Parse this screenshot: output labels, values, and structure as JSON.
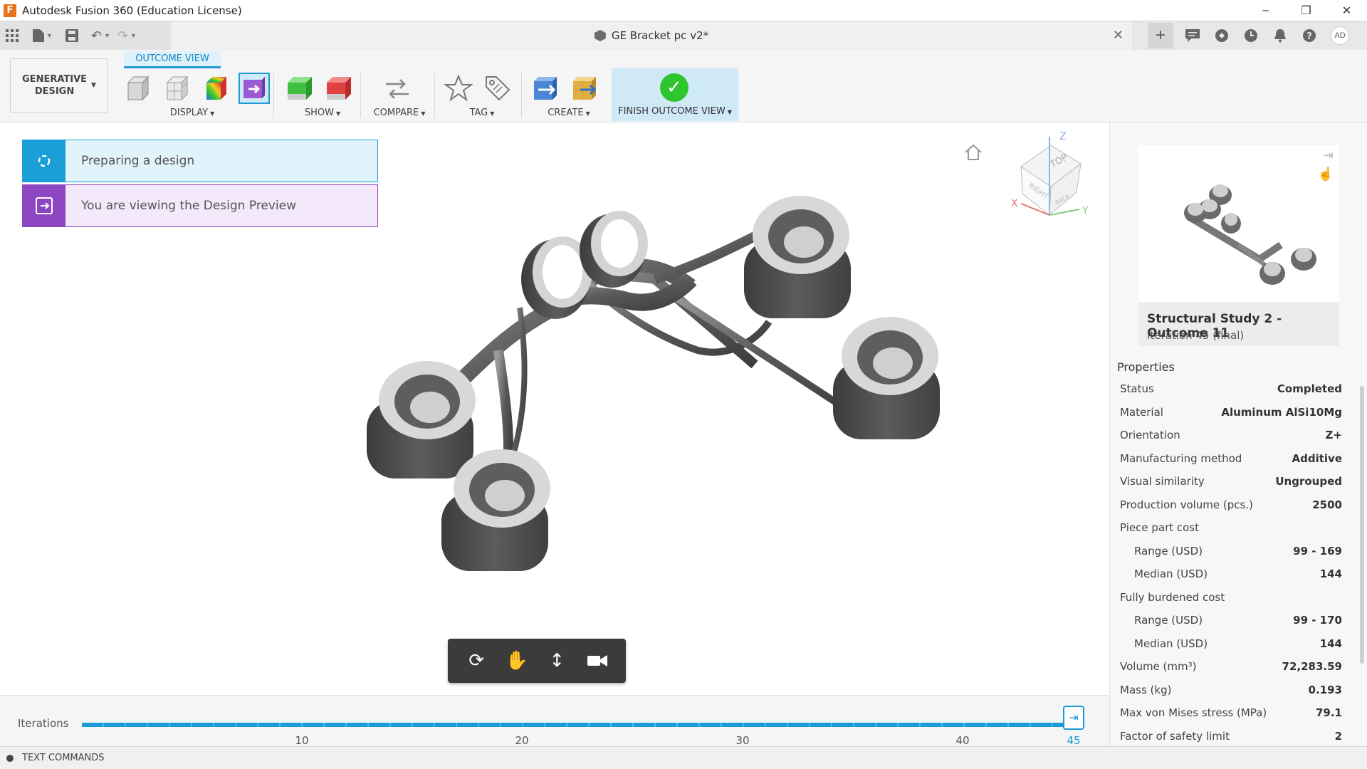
{
  "window": {
    "title": "Autodesk Fusion 360 (Education License)",
    "app_letter": "F",
    "controls": [
      "–",
      "❐",
      "✕"
    ]
  },
  "document": {
    "name": "GE Bracket pc v2*",
    "user_initials": "AD"
  },
  "ribbon": {
    "workspace_line1": "GENERATIVE",
    "workspace_line2": "DESIGN",
    "active_tab": "OUTCOME VIEW",
    "groups": {
      "display": "DISPLAY",
      "show": "SHOW",
      "compare": "COMPARE",
      "tag": "TAG",
      "create": "CREATE",
      "finish": "FINISH OUTCOME VIEW"
    }
  },
  "notices": {
    "preparing": "Preparing a design",
    "viewing": "You are viewing the Design Preview"
  },
  "timeline": {
    "label": "Iterations",
    "ticks": [
      "10",
      "20",
      "30",
      "40",
      "45"
    ],
    "current_iteration": 45
  },
  "text_commands": "TEXT COMMANDS",
  "outcome": {
    "title": "Structural Study 2 - Outcome 11",
    "subtitle": "Iteration 45 (final)"
  },
  "properties": {
    "heading": "Properties",
    "rows": [
      {
        "label": "Status",
        "value": "Completed",
        "sub": false
      },
      {
        "label": "Material",
        "value": "Aluminum AlSi10Mg",
        "sub": false
      },
      {
        "label": "Orientation",
        "value": "Z+",
        "sub": false
      },
      {
        "label": "Manufacturing method",
        "value": "Additive",
        "sub": false
      },
      {
        "label": "Visual similarity",
        "value": "Ungrouped",
        "sub": false
      },
      {
        "label": "Production volume (pcs.)",
        "value": "2500",
        "sub": false
      },
      {
        "label": "Piece part cost",
        "value": "",
        "sub": false
      },
      {
        "label": "Range (USD)",
        "value": "99 - 169",
        "sub": true
      },
      {
        "label": "Median (USD)",
        "value": "144",
        "sub": true
      },
      {
        "label": "Fully burdened cost",
        "value": "",
        "sub": false
      },
      {
        "label": "Range (USD)",
        "value": "99 - 170",
        "sub": true
      },
      {
        "label": "Median (USD)",
        "value": "144",
        "sub": true
      },
      {
        "label": "Volume (mm³)",
        "value": "72,283.59",
        "sub": false
      },
      {
        "label": "Mass (kg)",
        "value": "0.193",
        "sub": false
      },
      {
        "label": "Max von Mises stress (MPa)",
        "value": "79.1",
        "sub": false
      },
      {
        "label": "Factor of safety limit",
        "value": "2",
        "sub": false
      }
    ]
  },
  "viewcube": {
    "top": "TOP",
    "right": "RIGHT",
    "back": "BACK",
    "x": "X",
    "y": "Y",
    "z": "Z"
  },
  "colors": {
    "accent": "#1a9bd6",
    "purple": "#8e45c2",
    "success": "#2ec52e"
  }
}
